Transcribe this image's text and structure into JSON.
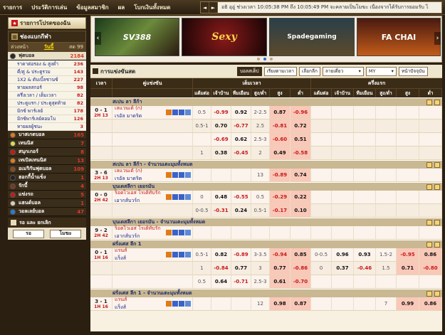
{
  "topmenu": [
    "รายการ",
    "ประวัติการเล่น",
    "ข้อมูลสมาชิก",
    "ผล",
    "โบกเงินทั้งหมด"
  ],
  "marquee": {
    "prev": "◄",
    "next": "►",
    "text": "อธิ อุอู่ ช่วงเวลา 10:05:38 PM ถึง 10:05:49 PM จะคลายเป็นโมฆะ เนื่องจากได้รับการยอมรับ ไ"
  },
  "sidebar": {
    "favorites": "รายการโปรดของฉัน",
    "header": "ช่องแบกกีฬา",
    "tabs": {
      "early": "ล่วงหน้า",
      "today": "วันนี้",
      "live": "สด 99"
    },
    "sports": [
      {
        "name": "ฟุตบอล",
        "count": "2184",
        "color": "#2a2a2a",
        "open": true
      },
      {
        "name": "บาสเกตบอล",
        "count": "165",
        "color": "#e07b1a"
      },
      {
        "name": "เทนนิส",
        "count": "7",
        "color": "#d8e04a"
      },
      {
        "name": "สนุกเกอร์",
        "count": "8",
        "color": "#c71818"
      },
      {
        "name": "เทเบิลเทนนิส",
        "count": "13",
        "color": "#e07b1a"
      },
      {
        "name": "อเมริกันฟุตบอล",
        "count": "109",
        "color": "#8a4a1a"
      },
      {
        "name": "ฮอกกี้น้ำแข็ง",
        "count": "1",
        "color": "#222"
      },
      {
        "name": "รักบี้",
        "count": "4",
        "color": "#7a3a1a"
      },
      {
        "name": "แข่งรถ",
        "count": "5",
        "color": "#c71818"
      },
      {
        "name": "แฮนด์บอล",
        "count": "1",
        "color": "#d8d0b0"
      },
      {
        "name": "วอลเลย์บอล",
        "count": "47",
        "color": "#2a7ad8"
      }
    ],
    "soccer_subs": [
      {
        "label": "ราคาต่อรอง & สูงต่ำ",
        "count": "236"
      },
      {
        "label": "คี่/คู่ & ประตูรวม",
        "count": "143"
      },
      {
        "label": "1X2 & ดับเบิ้ลชานซ์",
        "count": "227"
      },
      {
        "label": "ทายผลสกอร์",
        "count": "98"
      },
      {
        "label": "ครึ่งเวลา / เต็มเวลา",
        "count": "82"
      },
      {
        "label": "ประตูแรก / ประตูสุดท้าย",
        "count": "82"
      },
      {
        "label": "มิกซ์ พาร์เลย์",
        "count": "178"
      },
      {
        "label": "มิกซ์พาร์เลย์คอมโบ",
        "count": "126"
      },
      {
        "label": "ทายผลผู้ชนะ",
        "count": "3"
      }
    ],
    "search": "รอ และ ยกเลิก",
    "btn_wait": "รอ",
    "btn_void": "โมฆะ"
  },
  "banner": {
    "slide1": "SV388",
    "slide2": "Sexy",
    "slide3": "Spadegaming",
    "slide4": "FA CHAI",
    "prev": "‹",
    "next": "›"
  },
  "filters": {
    "title": "การแข่งขันสด",
    "btn_bet": "บอลสเต็ป",
    "sort": "เรียงตามเวลา",
    "select_league": "เลือกลีก",
    "odds_type": "ลายเดี่ยว",
    "currency": "MY",
    "view": "หน้าปัจจุบัน"
  },
  "headers": {
    "time": "เวลา",
    "match": "คู่แข่งขัน",
    "full": "เต็มเวลา",
    "half": "ครึ่งแรก",
    "sub": [
      "แต้มต่อ",
      "เจ้าบ้าน",
      "ทีมเยือน",
      "สูง/ต่ำ",
      "สูง",
      "ต่ำ"
    ]
  },
  "leagues": [
    {
      "name": "สเปน ลา ลีก้า",
      "matches": [
        {
          "score": "0 - 1",
          "min": "2H 13",
          "home": "เลแวนเต้ (ก)",
          "away": "เรอัล มาดริด",
          "lines": [
            [
              "0.5",
              "-0.99",
              "0.92",
              "2-2.5",
              "0.87",
              "-0.96"
            ],
            [
              "0.5-1",
              "0.70",
              "-0.77",
              "2.5",
              "-0.81",
              "0.72"
            ],
            [
              "",
              "-0.69",
              "0.62",
              "2.5-3",
              "-0.60",
              "0.51"
            ],
            [
              "1",
              "0.38",
              "-0.45",
              "2",
              "0.49",
              "-0.58"
            ]
          ]
        }
      ]
    },
    {
      "name": "สเปน ลา ลีก้า - จำนวนเตะมุมทั้งหมด",
      "matches": [
        {
          "score": "3 - 6",
          "min": "2H 13",
          "home": "เลแวนเต้ (ก)",
          "away": "เรอัล มาดริด",
          "lines": [
            [
              "",
              "",
              "",
              "13",
              "-0.89",
              "0.74"
            ]
          ]
        }
      ]
    },
    {
      "name": "บุนเดสลีกา เยอรมัน",
      "matches": [
        {
          "score": "0 - 0",
          "min": "2H 42",
          "home": "ร็อตไวเอส โรเต้ทับรัก",
          "away": "เอากส์บวร์ก",
          "lines": [
            [
              "0",
              "0.48",
              "-0.55",
              "0.5",
              "-0.29",
              "0.22"
            ],
            [
              "0-0.5",
              "-0.31",
              "0.24",
              "0.5-1",
              "-0.17",
              "0.10"
            ]
          ]
        }
      ]
    },
    {
      "name": "บุนเดสลีกา เยอรมัน - จำนวนเตะมุมทั้งหมด",
      "matches": [
        {
          "score": "9 - 2",
          "min": "2H 42",
          "home": "ร็อตไวเอส โรเต้ทับรัก",
          "away": "เอากส์บวร์ก",
          "lines": [
            [
              "",
              "",
              "",
              "",
              "",
              ""
            ]
          ]
        }
      ]
    },
    {
      "name": "ฝรั่งเศส ลีก 1",
      "matches": [
        {
          "score": "0 - 1",
          "min": "1H 16",
          "home": "แรนส์",
          "away": "แร็งส์",
          "lines": [
            [
              "0.5-1",
              "0.82",
              "-0.89",
              "3-3.5",
              "-0.94",
              "0.85",
              "0-0.5",
              "0.96",
              "0.93",
              "1.5-2",
              "-0.95",
              "0.86"
            ],
            [
              "1",
              "-0.84",
              "0.77",
              "3",
              "0.77",
              "-0.86",
              "0",
              "0.37",
              "-0.46",
              "1.5",
              "0.71",
              "-0.80"
            ],
            [
              "0.5",
              "0.64",
              "-0.71",
              "2.5-3",
              "0.61",
              "-0.70",
              "",
              "",
              "",
              "",
              "",
              ""
            ]
          ]
        }
      ]
    },
    {
      "name": "ฝรั่งเศส ลีก 1 - จำนวนเตะมุมทั้งหมด",
      "matches": [
        {
          "score": "3 - 1",
          "min": "1H 16",
          "home": "แรนส์",
          "away": "แร็งส์",
          "lines": [
            [
              "",
              "",
              "",
              "12",
              "0.98",
              "0.87",
              "",
              "",
              "",
              "7",
              "0.99",
              "0.86"
            ]
          ]
        }
      ]
    }
  ]
}
